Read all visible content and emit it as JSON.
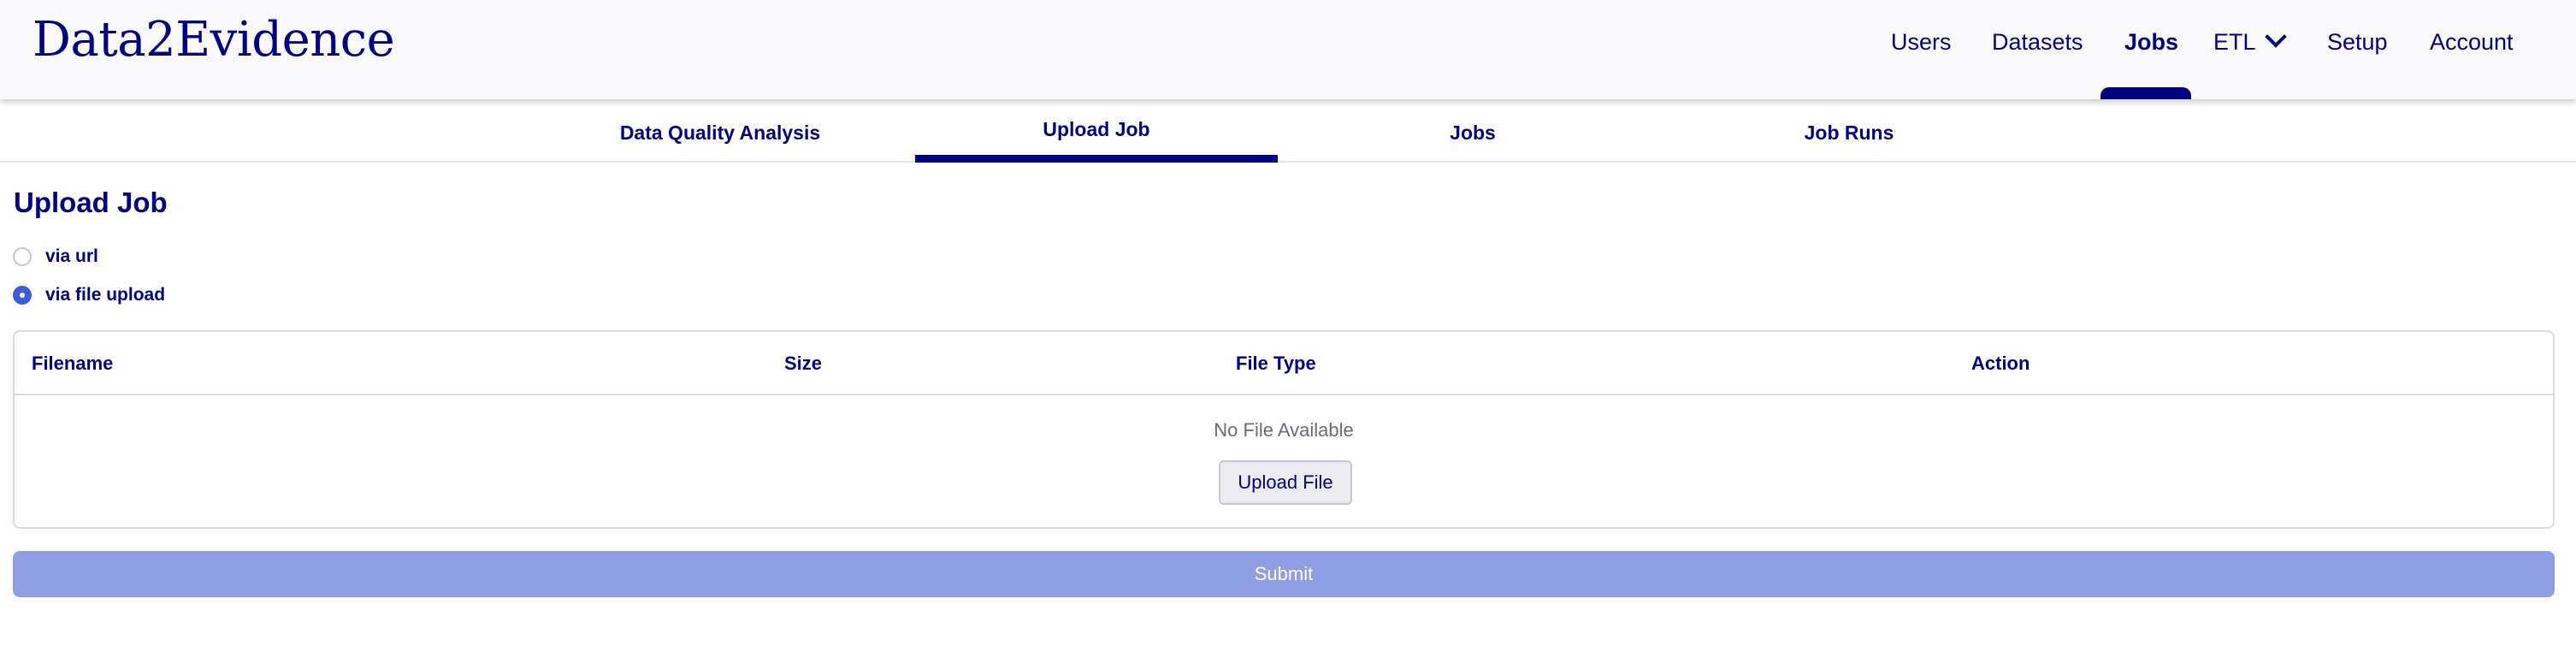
{
  "app": {
    "brand": "Data2Evidence"
  },
  "topnav": {
    "items": [
      {
        "label": "Users"
      },
      {
        "label": "Datasets"
      },
      {
        "label": "Jobs",
        "active": true
      },
      {
        "label": "ETL",
        "has_dropdown": true
      },
      {
        "label": "Setup"
      },
      {
        "label": "Account"
      }
    ]
  },
  "subtabs": [
    {
      "label": "Data Quality Analysis"
    },
    {
      "label": "Upload Job",
      "active": true
    },
    {
      "label": "Jobs"
    },
    {
      "label": "Job Runs"
    }
  ],
  "page": {
    "title": "Upload Job"
  },
  "upload_mode": {
    "options": [
      {
        "label": "via url",
        "checked": false
      },
      {
        "label": "via file upload",
        "checked": true
      }
    ]
  },
  "file_table": {
    "columns": [
      "Filename",
      "Size",
      "File Type",
      "Action"
    ],
    "empty_text": "No File Available",
    "upload_label": "Upload File"
  },
  "submit_label": "Submit",
  "colors": {
    "primary": "#000080",
    "radio_checked": "#3b5bdb",
    "submit_disabled": "#8f9de3",
    "header_bg": "#f9f9fc"
  }
}
